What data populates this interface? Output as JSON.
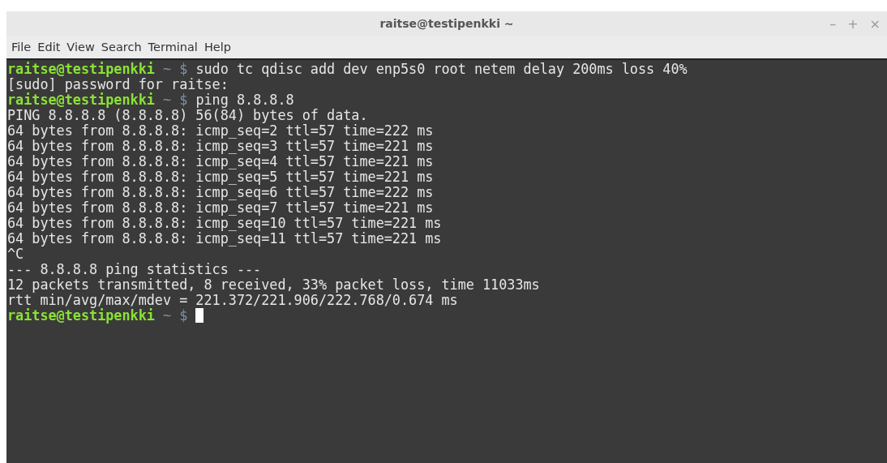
{
  "window": {
    "title": "raitse@testipenkki ~",
    "controls": [
      "–",
      "+",
      "×"
    ]
  },
  "menu": [
    "File",
    "Edit",
    "View",
    "Search",
    "Terminal",
    "Help"
  ],
  "lines": [
    {
      "kind": "prompt",
      "user_host": "raitse@testipenkki",
      "path": "~",
      "symbol": "$",
      "command": "sudo tc qdisc add dev enp5s0 root netem delay 200ms loss 40%"
    },
    {
      "kind": "output",
      "text": "[sudo] password for raitse:"
    },
    {
      "kind": "prompt",
      "user_host": "raitse@testipenkki",
      "path": "~",
      "symbol": "$",
      "command": "ping 8.8.8.8"
    },
    {
      "kind": "output",
      "text": "PING 8.8.8.8 (8.8.8.8) 56(84) bytes of data."
    },
    {
      "kind": "output",
      "text": "64 bytes from 8.8.8.8: icmp_seq=2 ttl=57 time=222 ms"
    },
    {
      "kind": "output",
      "text": "64 bytes from 8.8.8.8: icmp_seq=3 ttl=57 time=221 ms"
    },
    {
      "kind": "output",
      "text": "64 bytes from 8.8.8.8: icmp_seq=4 ttl=57 time=221 ms"
    },
    {
      "kind": "output",
      "text": "64 bytes from 8.8.8.8: icmp_seq=5 ttl=57 time=221 ms"
    },
    {
      "kind": "output",
      "text": "64 bytes from 8.8.8.8: icmp_seq=6 ttl=57 time=222 ms"
    },
    {
      "kind": "output",
      "text": "64 bytes from 8.8.8.8: icmp_seq=7 ttl=57 time=221 ms"
    },
    {
      "kind": "output",
      "text": "64 bytes from 8.8.8.8: icmp_seq=10 ttl=57 time=221 ms"
    },
    {
      "kind": "output",
      "text": "64 bytes from 8.8.8.8: icmp_seq=11 ttl=57 time=221 ms"
    },
    {
      "kind": "output",
      "text": "^C"
    },
    {
      "kind": "output",
      "text": "--- 8.8.8.8 ping statistics ---"
    },
    {
      "kind": "output",
      "text": "12 packets transmitted, 8 received, 33% packet loss, time 11033ms"
    },
    {
      "kind": "output",
      "text": "rtt min/avg/max/mdev = 221.372/221.906/222.768/0.674 ms"
    },
    {
      "kind": "prompt",
      "user_host": "raitse@testipenkki",
      "path": "~",
      "symbol": "$",
      "cursor": true
    }
  ]
}
